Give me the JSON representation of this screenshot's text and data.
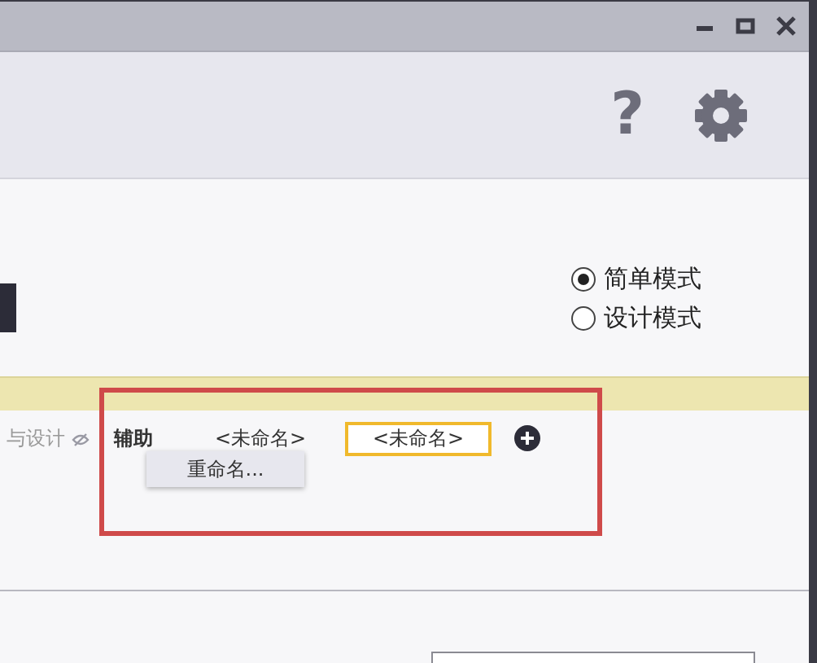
{
  "window": {
    "controls": [
      {
        "kind": "minimize"
      },
      {
        "kind": "maximize"
      },
      {
        "kind": "close"
      }
    ]
  },
  "toolbar": {
    "help": "?"
  },
  "mode_options": [
    {
      "label": "简单模式",
      "selected": true
    },
    {
      "label": "设计模式",
      "selected": false
    }
  ],
  "layer_tabs": [
    {
      "label": "与设计",
      "selected": false,
      "hidden": true
    },
    {
      "label": "辅助",
      "selected": false,
      "hidden": false
    },
    {
      "label": "<未命名>",
      "selected": false,
      "hidden": false
    },
    {
      "label": "<未命名>",
      "selected": true,
      "hidden": false
    }
  ],
  "context_menu": {
    "items": [
      "重命名..."
    ]
  }
}
